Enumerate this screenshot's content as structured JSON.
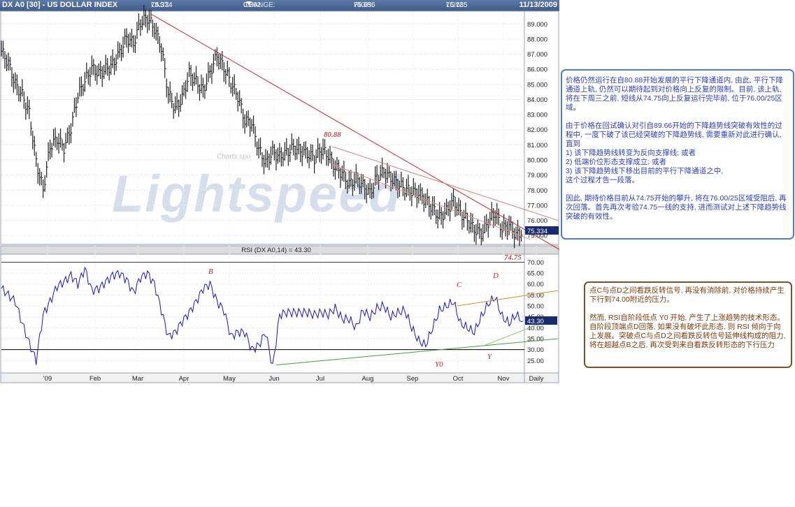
{
  "header": {
    "symbol": "DX A0 [30] - US DOLLAR INDEX",
    "last_label": "LAST:",
    "last": "75.334",
    "change_label": "CHANGE:",
    "change": "0.262",
    "high_label": "HIGH:",
    "high": "75.656",
    "low_label": "LOW:",
    "low": "75.135",
    "date": "11/13/2009"
  },
  "watermark": {
    "text": "Lightspeed",
    "sub": "Charts spo"
  },
  "colors": {
    "bar": "#1f1f1f",
    "rsi": "#1515c8",
    "trend_red": "#cc2a2a",
    "trend_green": "#3aa53a",
    "trend_orange": "#e08a1a",
    "accent": "#4a7be0",
    "brown": "#8a4a22"
  },
  "chart_data": [
    {
      "type": "ohlc",
      "title": "DX A0 [30] - US DOLLAR INDEX",
      "ylim": [
        74.5,
        89.8
      ],
      "y_ticks": [
        "89.000",
        "88.000",
        "87.000",
        "86.000",
        "85.000",
        "84.000",
        "83.000",
        "82.000",
        "81.000",
        "80.000",
        "79.000",
        "78.000",
        "77.000",
        "76.000",
        "75.000"
      ],
      "x_ticks": [
        "'09",
        "Feb",
        "Mar",
        "Apr",
        "May",
        "Jun",
        "Jul",
        "Aug",
        "Sep",
        "Oct",
        "Nov",
        "Daily"
      ],
      "last_price_label": "75.334",
      "series": [
        {
          "name": "price",
          "x": [
            0,
            10,
            20,
            30,
            40,
            50,
            60,
            70,
            80,
            90,
            100,
            110,
            120,
            130,
            140,
            150,
            160,
            170,
            180,
            190,
            200,
            210,
            220,
            230,
            240,
            250,
            260,
            270,
            280,
            290,
            300,
            310,
            320,
            330,
            340,
            350,
            360,
            370,
            380,
            390,
            400,
            410,
            420,
            430,
            440,
            450,
            460,
            470,
            480,
            490,
            500,
            510,
            520,
            530,
            540,
            550,
            560,
            570,
            580,
            590,
            600,
            610,
            620,
            630,
            640,
            650,
            660,
            670,
            680,
            690,
            700,
            710,
            720,
            730,
            740,
            750
          ],
          "values": [
            87.2,
            86.4,
            85.0,
            84.3,
            83.1,
            79.9,
            78.0,
            80.9,
            81.4,
            80.8,
            82.1,
            84.3,
            85.2,
            86.1,
            85.7,
            86.0,
            86.3,
            87.1,
            88.1,
            87.7,
            89.1,
            89.4,
            88.7,
            87.4,
            84.4,
            83.4,
            84.1,
            85.7,
            85.2,
            84.6,
            85.8,
            86.9,
            86.1,
            85.1,
            84.2,
            82.6,
            82.4,
            80.7,
            79.8,
            80.5,
            80.2,
            80.5,
            80.8,
            80.6,
            80.4,
            80.1,
            80.7,
            80.3,
            79.5,
            79.1,
            78.4,
            78.8,
            78.3,
            77.8,
            78.9,
            79.2,
            78.8,
            78.4,
            78.1,
            77.9,
            77.8,
            77.3,
            76.8,
            76.2,
            76.6,
            77.3,
            76.5,
            76.0,
            75.4,
            75.1,
            75.9,
            76.5,
            75.4,
            75.7,
            75.0,
            75.3
          ]
        }
      ],
      "trendlines": [
        {
          "name": "downtrend",
          "from": {
            "x": 215,
            "y": 89.66
          },
          "to": {
            "x": 805,
            "y": 74.0
          }
        },
        {
          "name": "channel-upper",
          "from": {
            "x": 476,
            "y": 80.88
          },
          "to": {
            "x": 800,
            "y": 76.0
          }
        },
        {
          "name": "channel-lower",
          "from": {
            "x": 476,
            "y": 79.7
          },
          "to": {
            "x": 760,
            "y": 74.75
          }
        }
      ],
      "annotations": [
        "80.88",
        "74.75"
      ]
    },
    {
      "type": "line",
      "title": "RSI (DX A0,14) = 43.30",
      "ylim": [
        20,
        73
      ],
      "y_ticks": [
        "70.00",
        "65.00",
        "60.00",
        "55.00",
        "50.00",
        "45.00",
        "40.00",
        "35.00",
        "30.00",
        "25.00"
      ],
      "last_value_label": "43.30",
      "reference_level": 30,
      "series": [
        {
          "name": "RSI",
          "x": [
            0,
            10,
            20,
            30,
            40,
            50,
            60,
            70,
            80,
            90,
            100,
            110,
            120,
            130,
            140,
            150,
            160,
            170,
            180,
            190,
            200,
            210,
            220,
            230,
            240,
            250,
            260,
            270,
            280,
            290,
            300,
            310,
            320,
            330,
            340,
            350,
            360,
            370,
            380,
            390,
            400,
            410,
            420,
            430,
            440,
            450,
            460,
            470,
            480,
            490,
            500,
            510,
            520,
            530,
            540,
            550,
            560,
            570,
            580,
            590,
            600,
            610,
            620,
            630,
            640,
            650,
            660,
            670,
            680,
            690,
            700,
            710,
            720,
            730,
            740,
            750
          ],
          "values": [
            58,
            55,
            52,
            42,
            33,
            25,
            46,
            52,
            59,
            61,
            64,
            60,
            67,
            57,
            58,
            61,
            64,
            65,
            62,
            56,
            63,
            65,
            60,
            48,
            36,
            38,
            43,
            47,
            52,
            58,
            60,
            52,
            48,
            36,
            38,
            38,
            30,
            32,
            38,
            22,
            46,
            47,
            47,
            47,
            47,
            46,
            47,
            46,
            49,
            44,
            44,
            40,
            48,
            45,
            49,
            50,
            45,
            47,
            48,
            40,
            34,
            32,
            40,
            48,
            50,
            52,
            42,
            40,
            38,
            45,
            51,
            54,
            45,
            42,
            46,
            43
          ]
        }
      ],
      "trendlines": [
        {
          "name": "support-green",
          "from": {
            "x": 395,
            "y": 23
          },
          "to": {
            "x": 800,
            "y": 35
          }
        },
        {
          "name": "support-green-2",
          "from": {
            "x": 695,
            "y": 32
          },
          "to": {
            "x": 800,
            "y": 45
          }
        },
        {
          "name": "resistance-orange",
          "from": {
            "x": 655,
            "y": 50
          },
          "to": {
            "x": 800,
            "y": 57
          }
        }
      ],
      "point_labels": [
        "B",
        "C",
        "D",
        "Y0",
        "Y"
      ]
    }
  ],
  "notes": {
    "blue": "价格仍然运行在自80.88开始发展的平行下降通道内, 由此, 平行下降通道上轨, 仍然可以期待起到对价格向上反复的限制。目前, 该上轨, 将在下周三之前, 短线从74.75向上反复运行完毕前, 位于76.00/25区域。\n\n由于价格在回试确认对引自89.66开始的下降趋势线突破有效性的过程中, 一度下破了该已经突破的下降趋势线, 需要重新对此进行确认, 直到\n1) 该下降趋势线转变为反向支撑线; 或者\n2) 低端价位形态支撑成立; 或者\n3) 该下降趋势线下移出目前的平行下降通道之中,\n这个过程才告一段落。\n\n因此, 期待价格目前从74.75开始的攀升, 将在76.00/25区域受阻后, 再次回落。首先再次考验74.75一线的支持, 进而测试对上述下降趋势线突破的有效性。",
    "brown": "点C与点D之间看跌反转信号, 再没有消除前, 对价格持续产生下行到74.00附近的压力。\n\n然而, RSI自阶段低点 Y0 开始, 产生了上涨趋势的技术形态。自阶段顶端点D回落, 如果没有破坏此形态, 则 RSI 倾向于向上发展。突破点C与点D之间看跌反转信号延伸线构成的阻力, 将在超越点B之后, 再次受到来自看跌反转形态的下行压力"
  }
}
